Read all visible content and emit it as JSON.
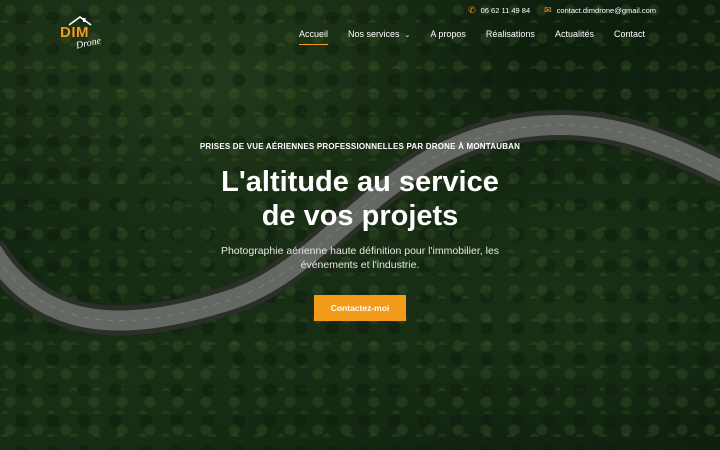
{
  "brand": {
    "logo_text": "DIM",
    "logo_script": "Drone"
  },
  "topbar": {
    "phone": "06 62 11 49 84",
    "email": "contact.dimdrone@gmail.com"
  },
  "nav": {
    "items": [
      {
        "label": "Accueil",
        "active": true
      },
      {
        "label": "Nos services",
        "has_dropdown": true
      },
      {
        "label": "A propos"
      },
      {
        "label": "Réalisations"
      },
      {
        "label": "Actualités"
      },
      {
        "label": "Contact"
      }
    ]
  },
  "hero": {
    "eyebrow": "PRISES DE VUE AÉRIENNES PROFESSIONNELLES PAR DRONE À MONTAUBAN",
    "headline_line1": "L'altitude au service",
    "headline_line2": "de vos projets",
    "subtitle": "Photographie aérienne haute définition pour l'immobilier, les événements et l'industrie.",
    "cta_label": "Contactez-moi"
  },
  "colors": {
    "accent": "#f29a1a"
  }
}
